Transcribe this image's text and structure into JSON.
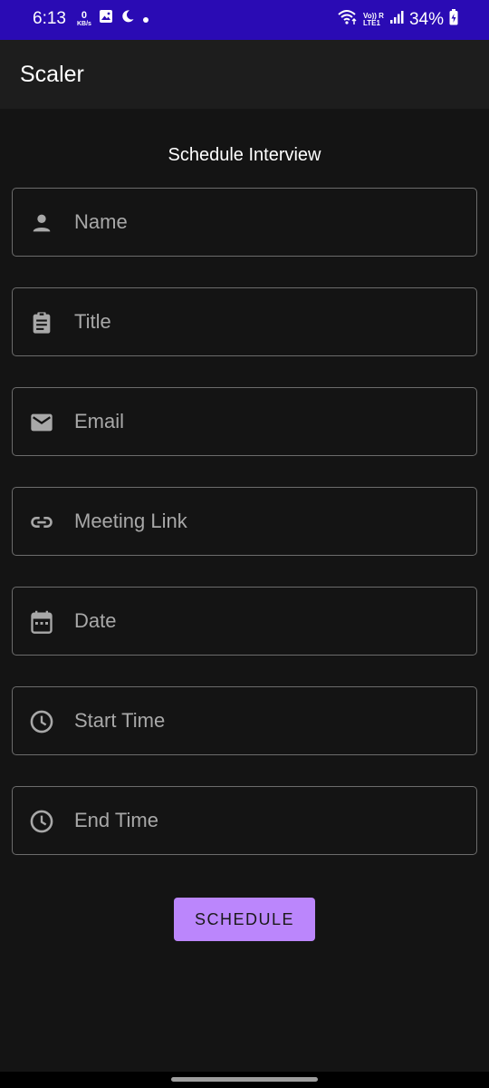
{
  "status_bar": {
    "time": "6:13",
    "data_rate_value": "0",
    "data_rate_unit": "KB/s",
    "volte_top": "Vo)) R",
    "volte_bottom": "LTE1",
    "battery": "34%",
    "background_color": "#2a0bb4"
  },
  "app_bar": {
    "title": "Scaler"
  },
  "form": {
    "title": "Schedule Interview",
    "fields": [
      {
        "placeholder": "Name",
        "icon": "person-icon"
      },
      {
        "placeholder": "Title",
        "icon": "clipboard-icon"
      },
      {
        "placeholder": "Email",
        "icon": "mail-icon"
      },
      {
        "placeholder": "Meeting Link",
        "icon": "link-icon"
      },
      {
        "placeholder": "Date",
        "icon": "calendar-icon"
      },
      {
        "placeholder": "Start Time",
        "icon": "clock-icon"
      },
      {
        "placeholder": "End Time",
        "icon": "clock-icon"
      }
    ],
    "submit_label": "SCHEDULE",
    "accent_color": "#bb86fc"
  }
}
